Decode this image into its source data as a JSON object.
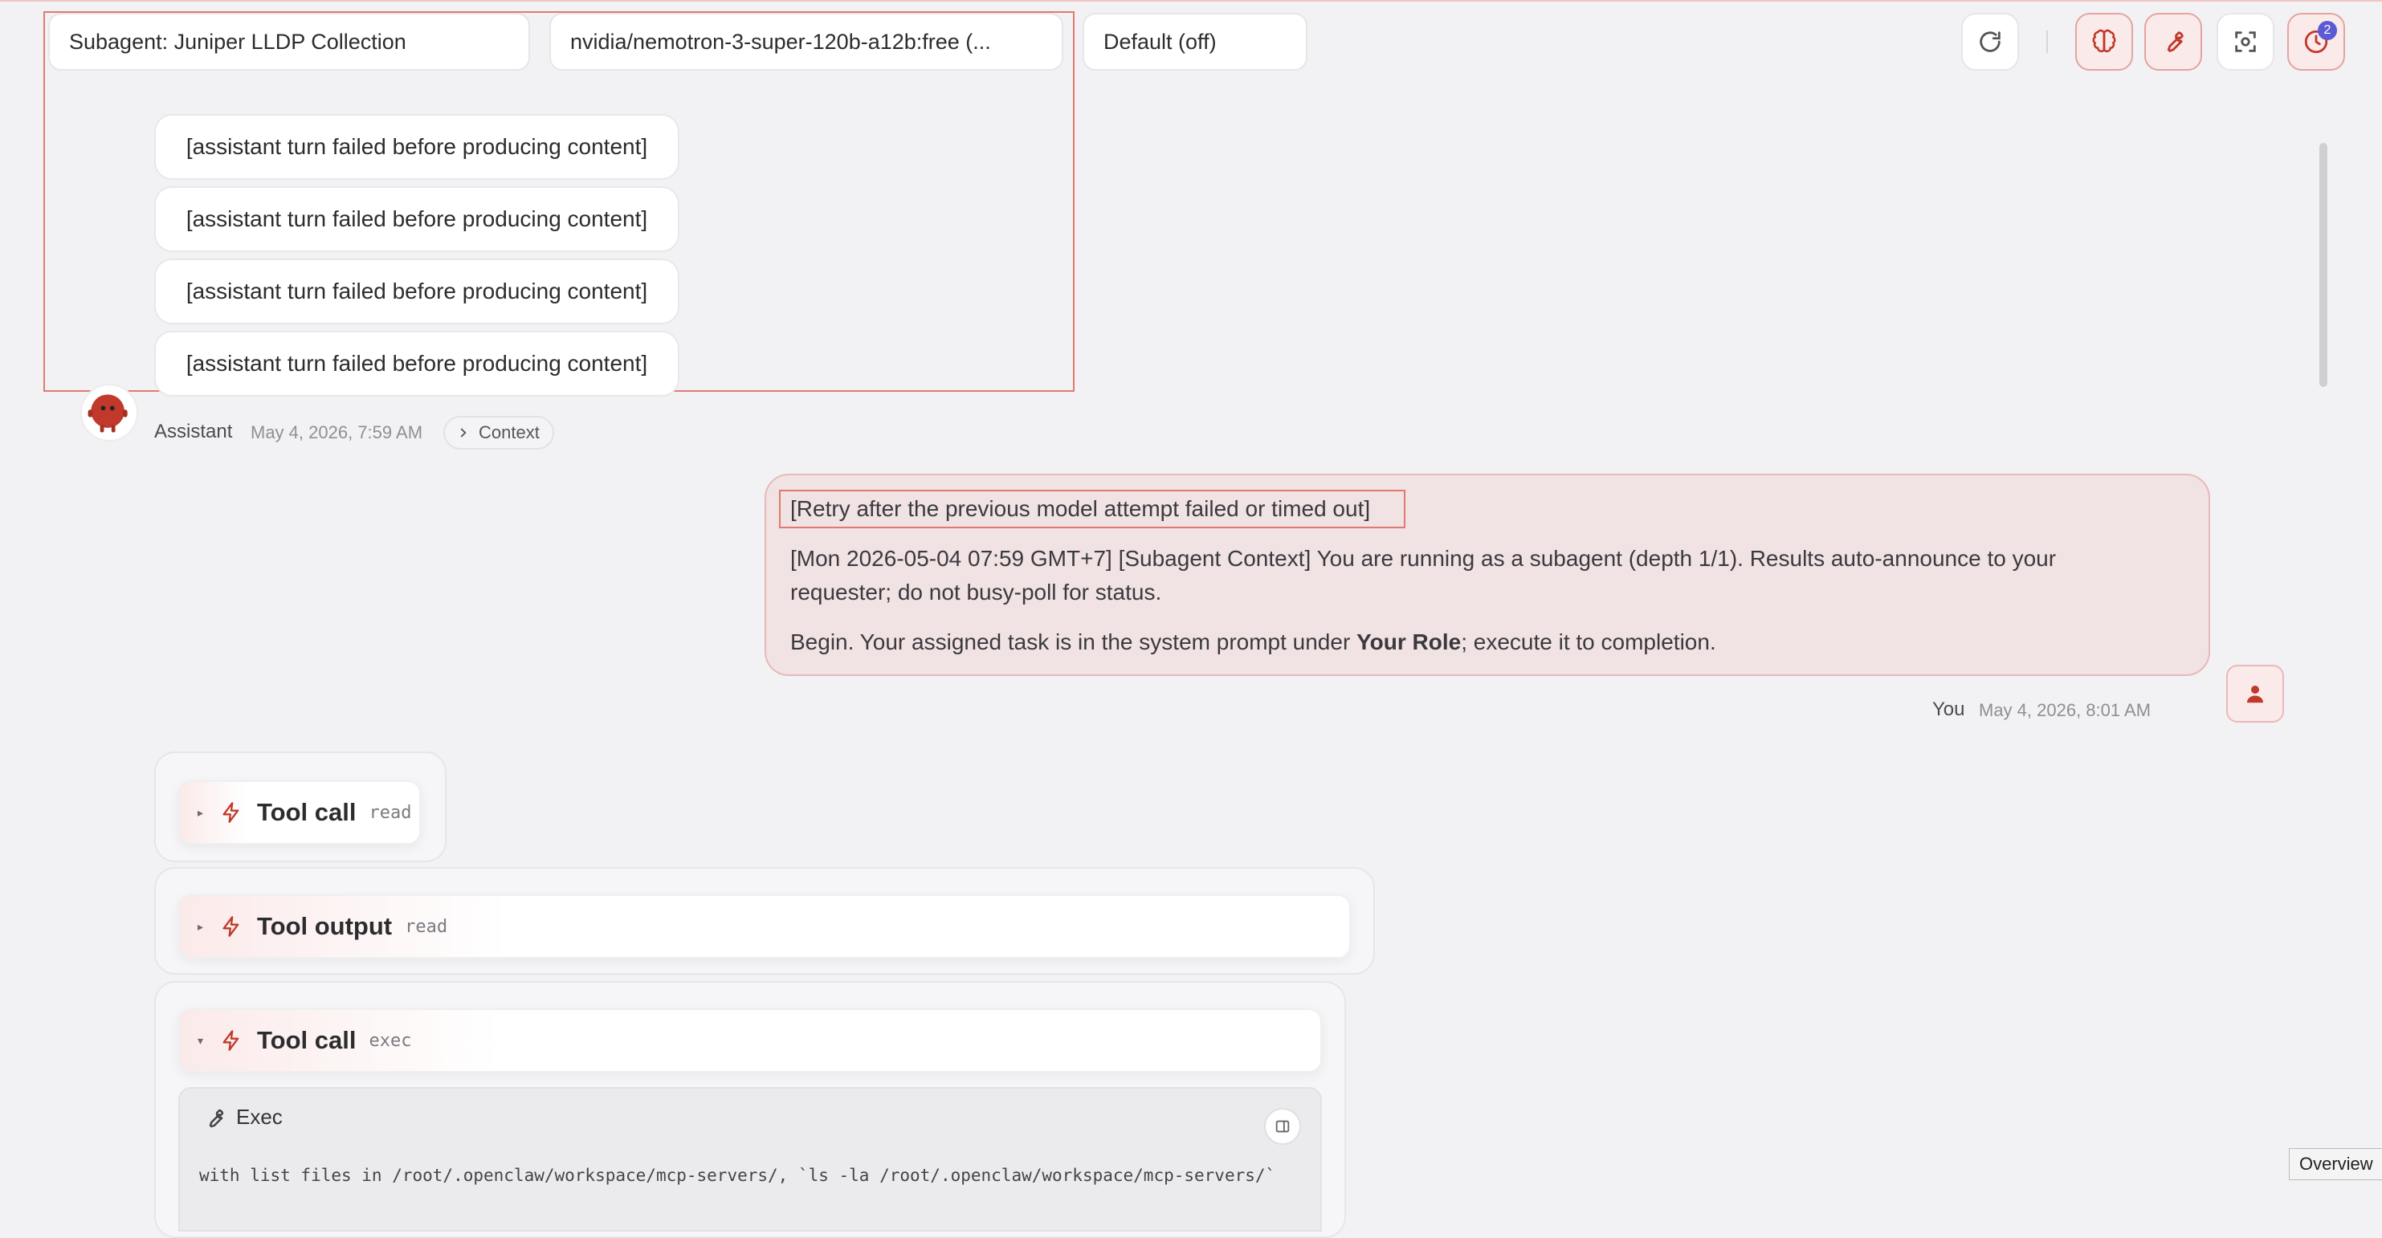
{
  "toolbar": {
    "agent_select": "Subagent: Juniper LLDP Collection",
    "model_select": "nvidia/nemotron-3-super-120b-a12b:free (...",
    "thinking_select": "Default (off)",
    "refresh_icon": "refresh-icon",
    "brain_icon": "brain-icon",
    "wrench_icon": "wrench-icon",
    "focus_icon": "focus-icon",
    "history_icon": "clock-icon",
    "history_badge": "2",
    "accent_color": "#c0392b"
  },
  "failed_turns": [
    "[assistant turn failed before producing content]",
    "[assistant turn failed before producing content]",
    "[assistant turn failed before producing content]",
    "[assistant turn failed before producing content]"
  ],
  "assistant_meta": {
    "name": "Assistant",
    "time": "May 4, 2026, 7:59 AM",
    "context_label": "Context"
  },
  "user_message": {
    "retry_line": "[Retry after the previous model attempt failed or timed out]",
    "line1": "[Mon 2026-05-04 07:59 GMT+7] [Subagent Context] You are running as a subagent (depth 1/1). Results auto-announce to your",
    "line2": "requester; do not busy-poll for status.",
    "line3_pre": "Begin. Your assigned task is in the system prompt under ",
    "line3_bold": "Your Role",
    "line3_post": "; execute it to completion.",
    "name": "You",
    "time": "May 4, 2026, 8:01 AM"
  },
  "tools": [
    {
      "title": "Tool call",
      "tag": "read"
    },
    {
      "title": "Tool output",
      "tag": "read"
    },
    {
      "title": "Tool call",
      "tag": "exec"
    }
  ],
  "exec": {
    "title": "Exec",
    "code": "with list files in /root/.openclaw/workspace/mcp-servers/, `ls -la /root/.openclaw/workspace/mcp-servers/`"
  },
  "overview_label": "Overview"
}
